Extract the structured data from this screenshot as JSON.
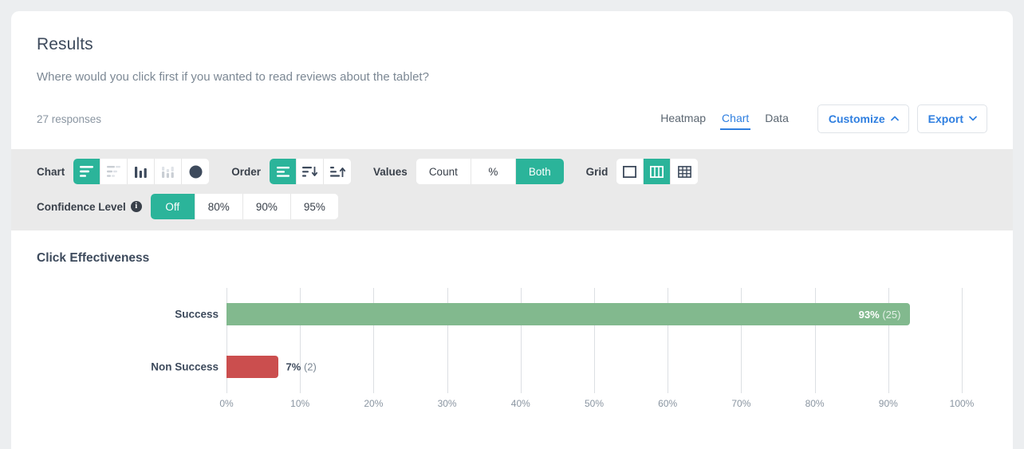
{
  "header": {
    "title": "Results",
    "question": "Where would you click first if you wanted to read reviews about the tablet?",
    "responses": "27 responses",
    "tabs": [
      {
        "label": "Heatmap",
        "active": false
      },
      {
        "label": "Chart",
        "active": true
      },
      {
        "label": "Data",
        "active": false
      }
    ],
    "customize_label": "Customize",
    "export_label": "Export"
  },
  "toolbar": {
    "chart_label": "Chart",
    "chart_options": [
      {
        "icon": "horizontal-bar-chart-icon",
        "active": true,
        "disabled": false
      },
      {
        "icon": "stacked-horizontal-bar-chart-icon",
        "active": false,
        "disabled": true
      },
      {
        "icon": "vertical-bar-chart-icon",
        "active": false,
        "disabled": false
      },
      {
        "icon": "stacked-vertical-bar-chart-icon",
        "active": false,
        "disabled": true
      },
      {
        "icon": "pie-chart-icon",
        "active": false,
        "disabled": false
      }
    ],
    "order_label": "Order",
    "order_options": [
      {
        "icon": "order-default-icon",
        "active": true
      },
      {
        "icon": "sort-descending-icon",
        "active": false
      },
      {
        "icon": "sort-ascending-icon",
        "active": false
      }
    ],
    "values_label": "Values",
    "values_options": [
      {
        "label": "Count",
        "active": false
      },
      {
        "label": "%",
        "active": false
      },
      {
        "label": "Both",
        "active": true
      }
    ],
    "grid_label": "Grid",
    "grid_options": [
      {
        "icon": "grid-none-icon",
        "active": false
      },
      {
        "icon": "grid-vertical-icon",
        "active": true
      },
      {
        "icon": "grid-full-icon",
        "active": false
      }
    ],
    "confidence_label": "Confidence Level",
    "confidence_info_icon": "info-icon",
    "confidence_options": [
      {
        "label": "Off",
        "active": true
      },
      {
        "label": "80%",
        "active": false
      },
      {
        "label": "90%",
        "active": false
      },
      {
        "label": "95%",
        "active": false
      }
    ]
  },
  "colors": {
    "accent_green": "#2bb49a",
    "success_bar": "#82b98e",
    "non_success_bar": "#cb4e4e",
    "link_blue": "#2f7fe0"
  },
  "chart_data": {
    "type": "bar",
    "orientation": "horizontal",
    "title": "Click Effectiveness",
    "xlabel": "",
    "ylabel": "",
    "xlim": [
      0,
      100
    ],
    "grid": "vertical",
    "categories": [
      "Success",
      "Non Success"
    ],
    "values": [
      93,
      7
    ],
    "counts": [
      25,
      2
    ],
    "value_labels": [
      "93%",
      "7%"
    ],
    "count_labels": [
      "(25)",
      "(2)"
    ],
    "colors": [
      "#82b98e",
      "#cb4e4e"
    ],
    "xticks": [
      "0%",
      "10%",
      "20%",
      "30%",
      "40%",
      "50%",
      "60%",
      "70%",
      "80%",
      "90%",
      "100%"
    ],
    "xtick_values": [
      0,
      10,
      20,
      30,
      40,
      50,
      60,
      70,
      80,
      90,
      100
    ]
  }
}
